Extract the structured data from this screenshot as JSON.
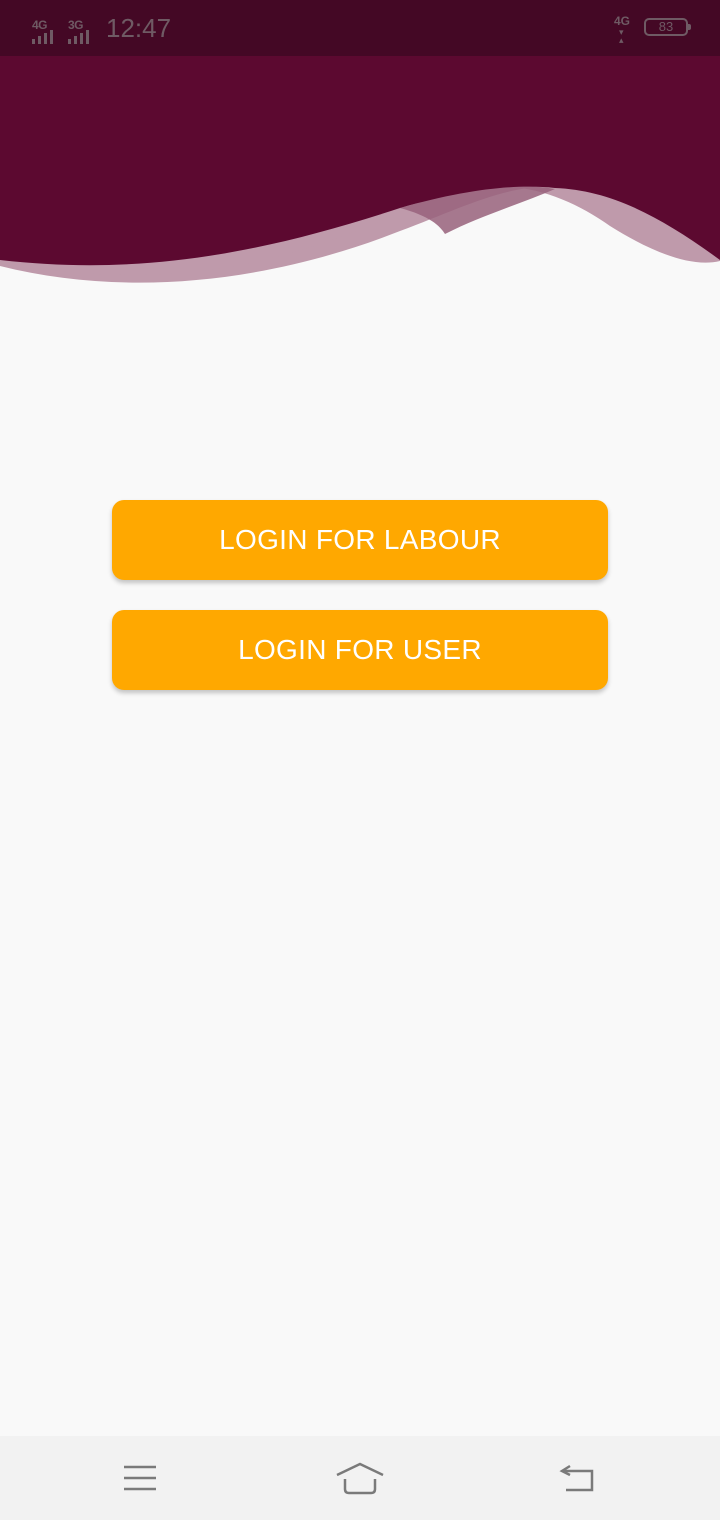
{
  "status_bar": {
    "network1": "4G",
    "network2": "3G",
    "time": "12:47",
    "network_right": "4G",
    "battery": "83"
  },
  "actions": {
    "labour_login_label": "LOGIN FOR LABOUR",
    "user_login_label": "LOGIN FOR USER"
  },
  "nav_bar": {
    "menu_icon": "menu-icon",
    "home_icon": "home-icon",
    "back_icon": "back-icon"
  },
  "colors": {
    "header": "#5c0930",
    "status_bar": "#440825",
    "wave_light": "#bf9aab",
    "button": "#ffa800",
    "background": "#f9f9f9"
  }
}
